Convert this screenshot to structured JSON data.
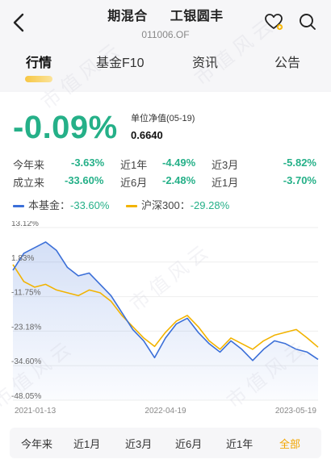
{
  "header": {
    "title_left": "期混合",
    "title_right": "工银圆丰",
    "fund_code": "011006.OF",
    "icons": [
      "back-arrow-icon",
      "heart-add-icon",
      "search-icon"
    ]
  },
  "tabs": [
    {
      "label": "行情",
      "active": true
    },
    {
      "label": "基金F10",
      "active": false
    },
    {
      "label": "资讯",
      "active": false
    },
    {
      "label": "公告",
      "active": false
    }
  ],
  "summary": {
    "change_pct": "-0.09%",
    "nav_label": "单位净值(05-19)",
    "nav_value": "0.6640"
  },
  "performance": [
    [
      {
        "label": "今年来",
        "value": "-3.63%"
      },
      {
        "label": "近1年",
        "value": "-4.49%"
      },
      {
        "label": "近3月",
        "value": "-5.82%"
      }
    ],
    [
      {
        "label": "成立来",
        "value": "-33.60%"
      },
      {
        "label": "近6月",
        "value": "-2.48%"
      },
      {
        "label": "近1月",
        "value": "-3.70%"
      }
    ]
  ],
  "legend": [
    {
      "name": "本基金：",
      "value": "-33.60%",
      "color": "#3b6fd8"
    },
    {
      "name": "沪深300：",
      "value": "-29.28%",
      "color": "#f2b300"
    }
  ],
  "watermark": "市值风云",
  "range_buttons": [
    {
      "label": "今年来",
      "active": false
    },
    {
      "label": "近1月",
      "active": false
    },
    {
      "label": "近3月",
      "active": false
    },
    {
      "label": "近6月",
      "active": false
    },
    {
      "label": "近1年",
      "active": false
    },
    {
      "label": "全部",
      "active": true
    }
  ],
  "chart_data": {
    "type": "line",
    "title": "",
    "ylim": [
      -48.05,
      13.12
    ],
    "y_ticks": [
      "13.12%",
      "1.83%",
      "-11.75%",
      "-23.18%",
      "-34.60%",
      "-48.05%"
    ],
    "x_ticks": [
      "2021-01-13",
      "2022-04-19",
      "2023-05-19"
    ],
    "x": [
      0,
      1,
      2,
      3,
      4,
      5,
      6,
      7,
      8,
      9,
      10,
      11,
      12,
      13,
      14,
      15,
      16,
      17,
      18,
      19,
      20,
      21,
      22,
      23,
      24,
      25,
      26,
      27,
      28
    ],
    "series": [
      {
        "name": "本基金",
        "color": "#3b6fd8",
        "values": [
          -2,
          4,
          6,
          8,
          5,
          -1,
          -4,
          -3,
          -7,
          -11,
          -17,
          -23,
          -27,
          -33,
          -26,
          -21,
          -19,
          -24,
          -28,
          -31,
          -27,
          -30,
          -34,
          -30,
          -27,
          -28,
          -30,
          -31,
          -33.6
        ]
      },
      {
        "name": "沪深300",
        "color": "#f2b300",
        "values": [
          0,
          -6,
          -8,
          -7,
          -9,
          -10,
          -11,
          -9,
          -10,
          -13,
          -18,
          -22,
          -26,
          -29,
          -24,
          -20,
          -18,
          -22,
          -27,
          -30,
          -26,
          -28,
          -30,
          -27,
          -25,
          -24,
          -23,
          -26,
          -29.28
        ]
      }
    ]
  }
}
